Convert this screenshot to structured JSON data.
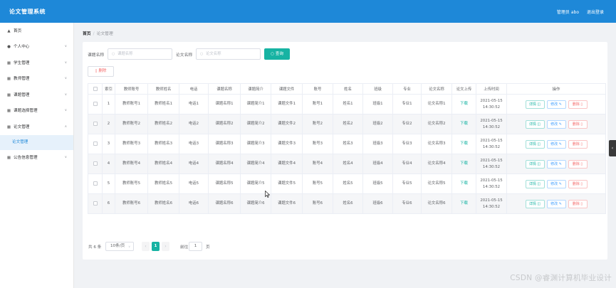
{
  "header": {
    "title": "论文管理系统",
    "user": "管理员 abo",
    "logout": "退出登录"
  },
  "sidebar": {
    "items": [
      {
        "label": "首页",
        "icon": "home-icon"
      },
      {
        "label": "个人中心",
        "icon": "person-icon"
      },
      {
        "label": "学生管理",
        "icon": "grid-icon"
      },
      {
        "label": "教师管理",
        "icon": "grid-icon"
      },
      {
        "label": "课题管理",
        "icon": "grid-icon"
      },
      {
        "label": "课题选择管理",
        "icon": "grid-icon"
      },
      {
        "label": "论文管理",
        "icon": "grid-icon"
      },
      {
        "label": "公告信息管理",
        "icon": "grid-icon"
      }
    ],
    "sub_item": "论文管理"
  },
  "breadcrumb": {
    "home": "首页",
    "sep": "/",
    "current": "论文管理"
  },
  "filters": {
    "topic_label": "课题名称",
    "topic_placeholder": "课题名称",
    "paper_label": "论文名称",
    "paper_placeholder": "论文名称"
  },
  "buttons": {
    "search": "查询",
    "delete": "删除"
  },
  "table": {
    "headers": [
      "索引",
      "教师账号",
      "教师姓名",
      "电话",
      "课题名称",
      "课题简介",
      "课题文件",
      "账号",
      "姓名",
      "班级",
      "专业",
      "论文名称",
      "论文上传",
      "上传时间",
      "操作"
    ],
    "rows": [
      [
        "1",
        "教师账号1",
        "教师姓名1",
        "电话1",
        "课题名称1",
        "课题简介1",
        "课题文件1",
        "账号1",
        "姓名1",
        "班级1",
        "专业1",
        "论文名称1",
        "下载",
        "2021-05-15 14:30:52"
      ],
      [
        "2",
        "教师账号2",
        "教师姓名2",
        "电话2",
        "课题名称2",
        "课题简介2",
        "课题文件2",
        "账号2",
        "姓名2",
        "班级2",
        "专业2",
        "论文名称2",
        "下载",
        "2021-05-15 14:30:52"
      ],
      [
        "3",
        "教师账号3",
        "教师姓名3",
        "电话3",
        "课题名称3",
        "课题简介3",
        "课题文件3",
        "账号3",
        "姓名3",
        "班级3",
        "专业3",
        "论文名称3",
        "下载",
        "2021-05-15 14:30:52"
      ],
      [
        "4",
        "教师账号4",
        "教师姓名4",
        "电话4",
        "课题名称4",
        "课题简介4",
        "课题文件4",
        "账号4",
        "姓名4",
        "班级4",
        "专业4",
        "论文名称4",
        "下载",
        "2021-05-15 14:30:52"
      ],
      [
        "5",
        "教师账号5",
        "教师姓名5",
        "电话5",
        "课题名称5",
        "课题简介5",
        "课题文件5",
        "账号5",
        "姓名5",
        "班级5",
        "专业5",
        "论文名称5",
        "下载",
        "2021-05-15 14:30:52"
      ],
      [
        "6",
        "教师账号6",
        "教师姓名6",
        "电话6",
        "课题名称6",
        "课题简介6",
        "课题文件6",
        "账号6",
        "姓名6",
        "班级6",
        "专业6",
        "论文名称6",
        "下载",
        "2021-05-15 14:30:52"
      ]
    ],
    "actions": {
      "detail": "详情",
      "edit": "修改",
      "delete": "删除"
    }
  },
  "pagination": {
    "total": "共 6 条",
    "page_size": "10条/页",
    "current_page": "1",
    "goto_label": "前往",
    "goto_value": "1",
    "page_unit": "页"
  },
  "watermark": "CSDN @睿渊计算机毕业设计",
  "colors": {
    "header": "#1e88d8",
    "accent": "#17b3a3",
    "danger": "#f56c6c",
    "primary": "#409eff"
  }
}
